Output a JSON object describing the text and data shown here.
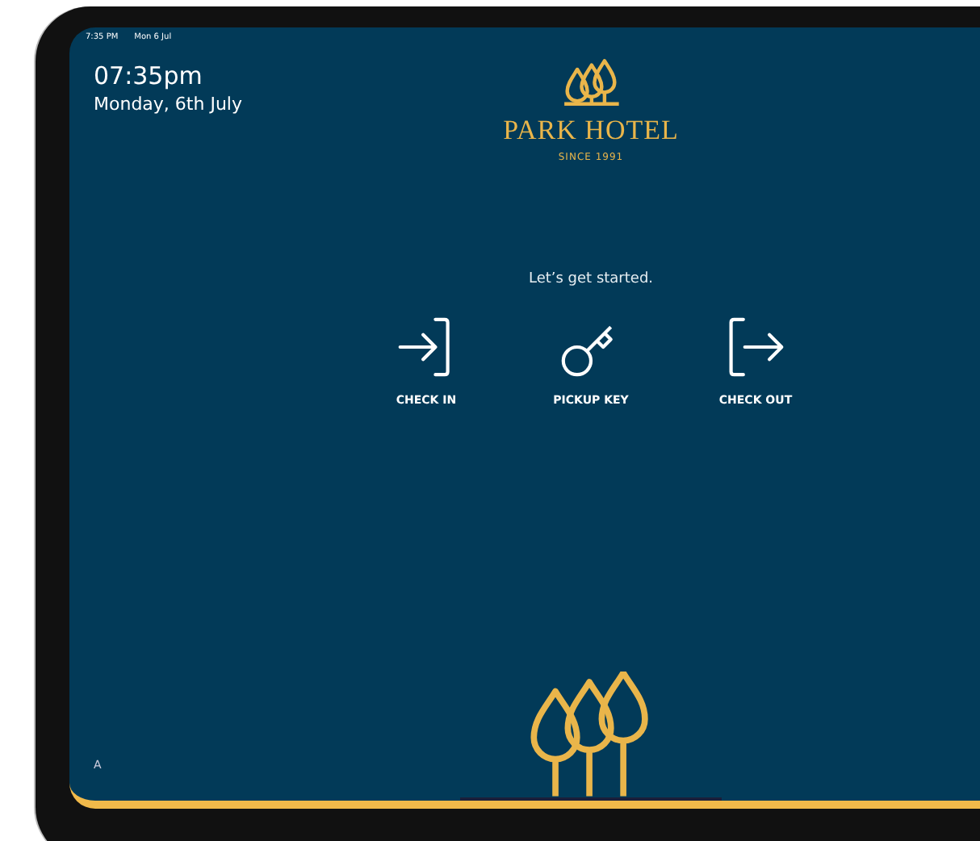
{
  "status_bar": {
    "time": "7:35 PM",
    "date": "Mon 6 Jul"
  },
  "clock": {
    "time": "07:35pm",
    "date": "Monday, 6th July"
  },
  "logo": {
    "name": "PARK HOTEL",
    "tagline": "SINCE 1991"
  },
  "prompt": "Let’s get started.",
  "actions": [
    {
      "kind": "check-in",
      "label": "CHECK IN"
    },
    {
      "kind": "pickup-key",
      "label": "PICKUP KEY"
    },
    {
      "kind": "check-out",
      "label": "CHECK OUT"
    }
  ],
  "footer": {
    "corner_text": "A"
  }
}
